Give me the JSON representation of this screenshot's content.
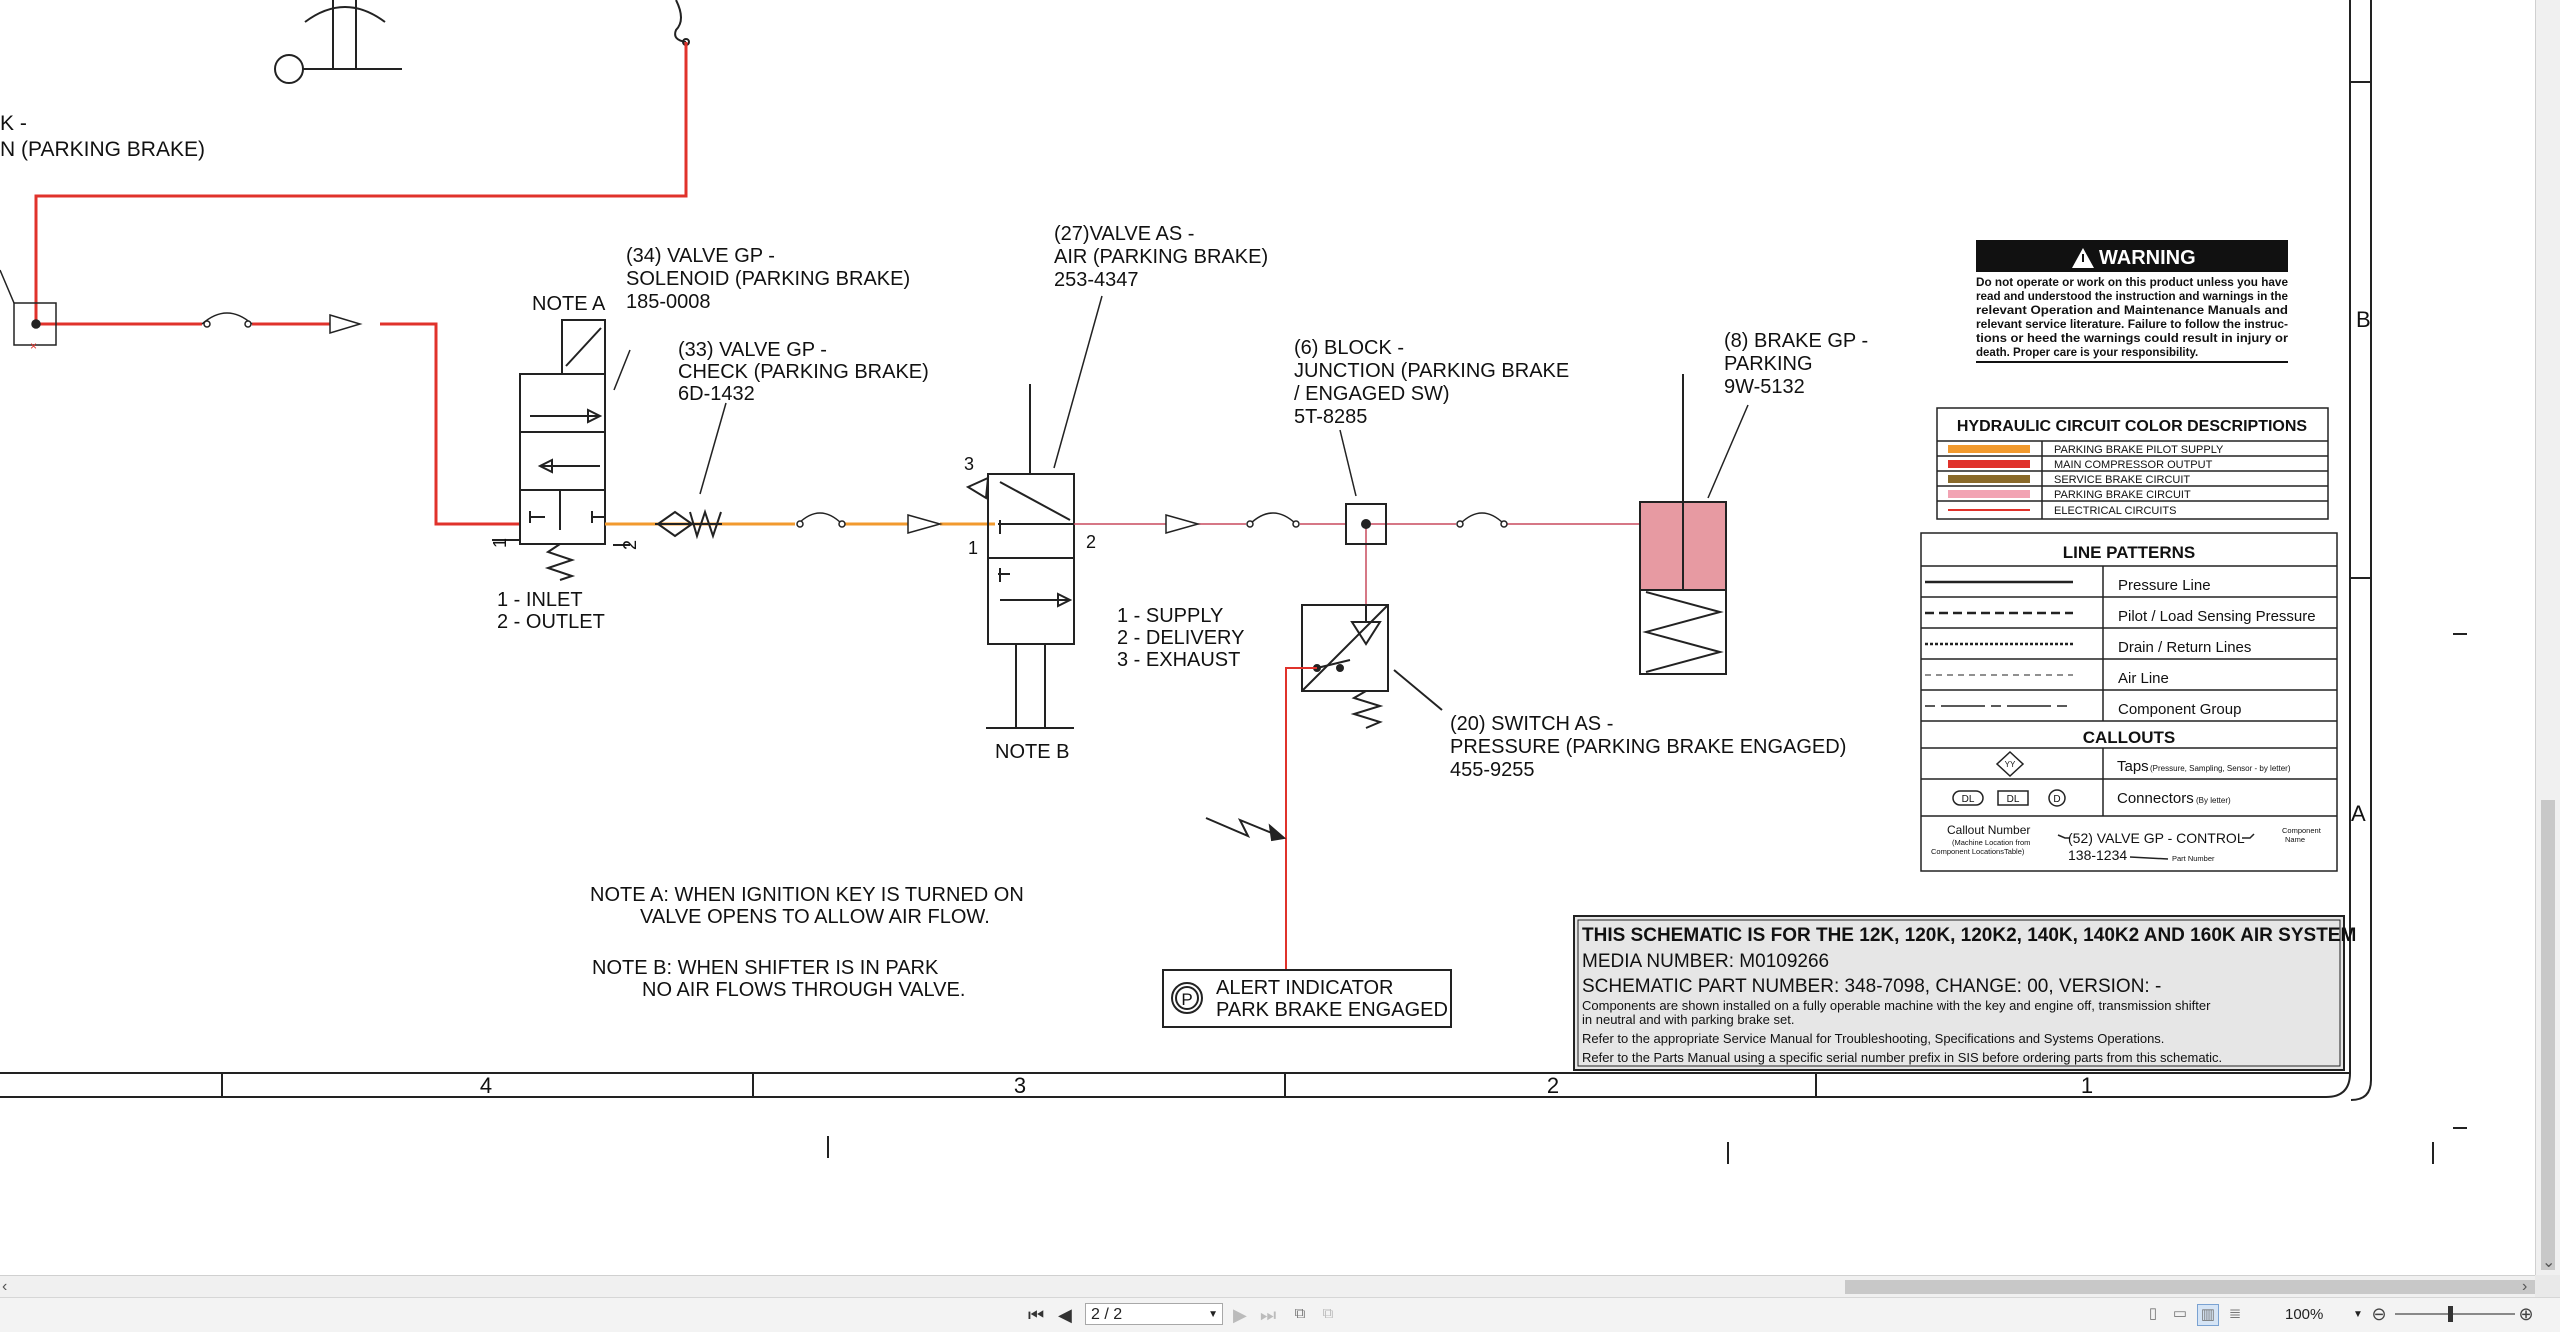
{
  "schematic": {
    "top_left": {
      "line1": "K -",
      "line2": "N (PARKING BRAKE)"
    },
    "valve34": {
      "line1": "(34) VALVE GP -",
      "line2": "SOLENOID (PARKING BRAKE)",
      "line3": "185-0008"
    },
    "note_a_label": "NOTE A",
    "valve33": {
      "line1": "(33) VALVE GP -",
      "line2": "CHECK (PARKING BRAKE)",
      "line3": "6D-1432"
    },
    "valve27": {
      "line1": "(27)VALVE AS -",
      "line2": "AIR (PARKING BRAKE)",
      "line3": "253-4347"
    },
    "block6": {
      "line1": "(6) BLOCK -",
      "line2": "JUNCTION (PARKING BRAKE",
      "line3": "/ ENGAGED SW)",
      "line4": "5T-8285"
    },
    "brake8": {
      "line1": "(8) BRAKE GP -",
      "line2": "PARKING",
      "line3": "9W-5132"
    },
    "port_1": "1",
    "port_2": "2",
    "port_3": "3",
    "inlet": "1 - INLET",
    "outlet": "2 - OUTLET",
    "supply": "1 - SUPPLY",
    "delivery": "2 - DELIVERY",
    "exhaust": "3 - EXHAUST",
    "note_b_label": "NOTE B",
    "switch20": {
      "line1": "(20) SWITCH AS -",
      "line2": "PRESSURE (PARKING BRAKE ENGAGED)",
      "line3": "455-9255"
    },
    "note_a": {
      "line1": "NOTE A:  WHEN IGNITION KEY IS TURNED ON",
      "line2": "VALVE OPENS TO ALLOW AIR FLOW."
    },
    "note_b": {
      "line1": "NOTE B:  WHEN SHIFTER IS IN PARK",
      "line2": "NO AIR FLOWS THROUGH VALVE."
    },
    "alert": {
      "symbol": "P",
      "line1": "ALERT INDICATOR",
      "line2": "PARK BRAKE ENGAGED"
    },
    "warning": {
      "title": "WARNING",
      "lines": [
        "Do not operate or work on this product unless you have",
        "read and understood the instruction and warnings in the",
        "relevant Operation and Maintenance Manuals and",
        "relevant service literature. Failure to follow the instruc-",
        "tions or heed the warnings could result in injury or",
        "death. Proper care is your responsibility."
      ]
    },
    "hydraulic_colors": {
      "title": "HYDRAULIC CIRCUIT COLOR DESCRIPTIONS",
      "items": [
        {
          "label": "PARKING BRAKE PILOT SUPPLY",
          "color": "#f29a2e"
        },
        {
          "label": "MAIN COMPRESSOR OUTPUT",
          "color": "#e0322b"
        },
        {
          "label": "SERVICE BRAKE CIRCUIT",
          "color": "#8a6a2a"
        },
        {
          "label": "PARKING BRAKE CIRCUIT",
          "color": "#f2a3b3"
        },
        {
          "label": "ELECTRICAL CIRCUITS",
          "color": "#e0322b"
        }
      ]
    },
    "line_patterns": {
      "title": "LINE PATTERNS",
      "items": [
        "Pressure Line",
        "Pilot / Load Sensing Pressure",
        "Drain / Return Lines",
        "Air Line",
        "Component Group"
      ]
    },
    "callouts": {
      "title": "CALLOUTS",
      "taps_symbol": "YY",
      "taps": "Taps",
      "taps_note": "(Pressure, Sampling, Sensor - by letter)",
      "conn_dl1": "DL",
      "conn_dl2": "DL",
      "conn_d": "D",
      "connectors": "Connectors",
      "connectors_note": "(By letter)",
      "callout_number": "Callout Number",
      "callout_sub1": "(Machine Location from",
      "callout_sub2": "Component LocationsTable)",
      "example": "(52) VALVE GP - CONTROL",
      "example_part": "138-1234",
      "component": "Component",
      "name": "Name",
      "part_number": "Part Number"
    },
    "title_block": {
      "header": "THIS SCHEMATIC IS FOR THE 12K, 120K, 120K2, 140K, 140K2  AND 160K AIR SYSTEM",
      "media": "MEDIA NUMBER: M0109266",
      "part": "SCHEMATIC PART NUMBER: 348-7098, CHANGE: 00, VERSION: -",
      "line1": "Components are shown installed on a fully operable machine with the key and engine off, transmission shifter",
      "line2": "in neutral and with parking brake set.",
      "line3": "Refer to the appropriate Service Manual for Troubleshooting, Specifications and Systems Operations.",
      "line4": "Refer to the Parts Manual using a specific serial number prefix in SIS before ordering parts from this schematic."
    },
    "zone_numbers": [
      "4",
      "3",
      "2",
      "1"
    ],
    "zone_letters": [
      "B",
      "A"
    ]
  },
  "toolbar": {
    "first_page": "⏮",
    "prev_page": "◀",
    "page_value": "2 / 2",
    "next_page": "▶",
    "last_page": "⏭",
    "zoom": "100%"
  }
}
